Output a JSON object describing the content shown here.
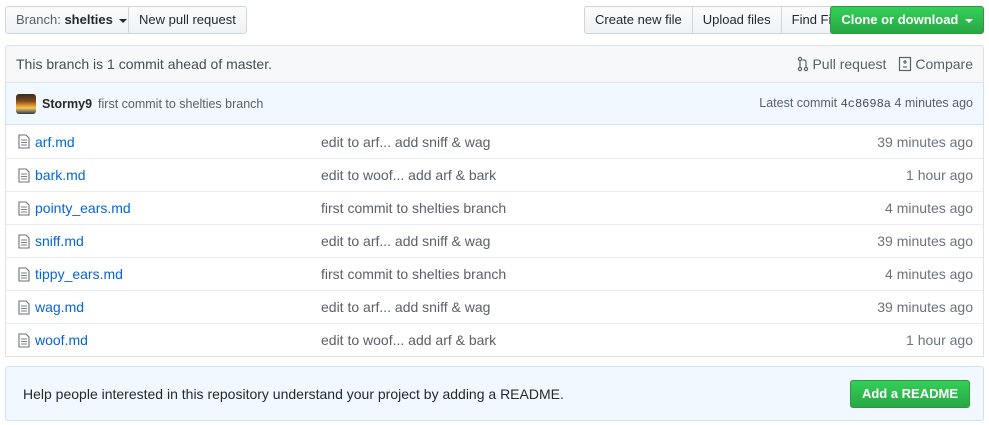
{
  "toolbar": {
    "branch_prefix": "Branch:",
    "branch_name": "shelties",
    "new_pull_request": "New pull request",
    "create_new_file": "Create new file",
    "upload_files": "Upload files",
    "find_file": "Find File",
    "clone_or_download": "Clone or download"
  },
  "branch_info": {
    "message": "This branch is 1 commit ahead of master.",
    "pull_request": "Pull request",
    "compare": "Compare"
  },
  "commit": {
    "author": "Stormy9",
    "message": "first commit to shelties branch",
    "latest_label": "Latest commit",
    "sha": "4c8698a",
    "age": "4 minutes ago"
  },
  "files": [
    {
      "name": "arf.md",
      "message": "edit to arf... add sniff & wag",
      "age": "39 minutes ago"
    },
    {
      "name": "bark.md",
      "message": "edit to woof... add arf & bark",
      "age": "1 hour ago"
    },
    {
      "name": "pointy_ears.md",
      "message": "first commit to shelties branch",
      "age": "4 minutes ago"
    },
    {
      "name": "sniff.md",
      "message": "edit to arf... add sniff & wag",
      "age": "39 minutes ago"
    },
    {
      "name": "tippy_ears.md",
      "message": "first commit to shelties branch",
      "age": "4 minutes ago"
    },
    {
      "name": "wag.md",
      "message": "edit to arf... add sniff & wag",
      "age": "39 minutes ago"
    },
    {
      "name": "woof.md",
      "message": "edit to woof... add arf & bark",
      "age": "1 hour ago"
    }
  ],
  "readme": {
    "message": "Help people interested in this repository understand your project by adding a README.",
    "button": "Add a README"
  },
  "icons": {
    "file": "file-icon",
    "pull_request": "git-pull-request-icon",
    "compare": "diff-icon",
    "caret": "caret-down-icon"
  },
  "colors": {
    "link": "#0366d6",
    "primary_button": "#28a745",
    "commit_bg": "#f1f8ff"
  }
}
